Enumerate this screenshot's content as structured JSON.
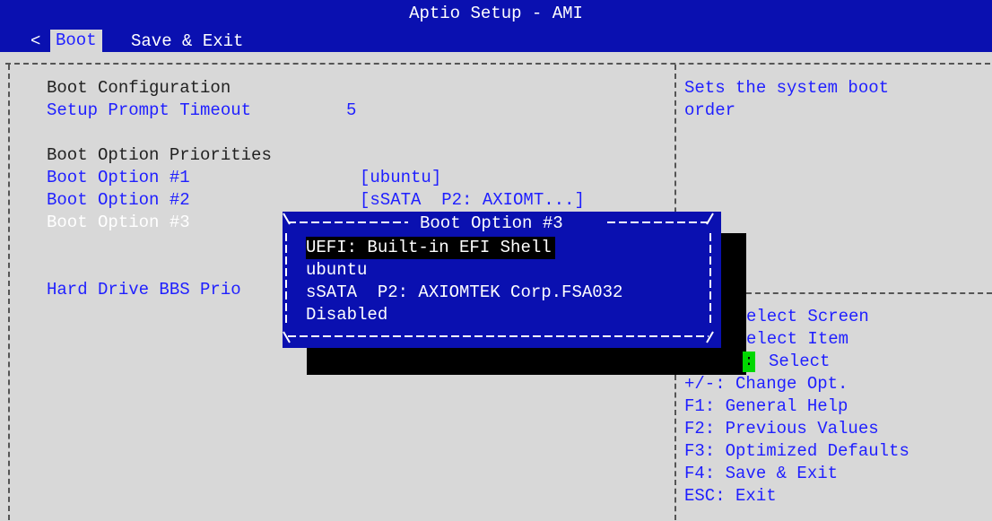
{
  "window": {
    "title": "Aptio Setup - AMI"
  },
  "tabs": {
    "left_arrow": "<",
    "items": [
      {
        "label": "Boot",
        "active": true
      },
      {
        "label": "Save & Exit",
        "active": false
      }
    ]
  },
  "main": {
    "boot_configuration_heading": "Boot Configuration",
    "setup_prompt_timeout": {
      "label": "Setup Prompt Timeout",
      "value": "5"
    },
    "boot_option_priorities_heading": "Boot Option Priorities",
    "boot_options": [
      {
        "label": "Boot Option #1",
        "value": "[ubuntu]"
      },
      {
        "label": "Boot Option #2",
        "value": "[sSATA  P2: AXIOMT...]"
      },
      {
        "label": "Boot Option #3",
        "value": ""
      }
    ],
    "hard_drive_bbs": {
      "label": "Hard Drive BBS Prio"
    }
  },
  "help": {
    "description_lines": [
      "Sets the system boot",
      "order"
    ]
  },
  "keys": {
    "select_screen_fragment": "elect Screen",
    "select_item_fragment": "elect Item",
    "select_marker": ":",
    "select_label": "Select",
    "change_opt": "+/-: Change Opt.",
    "general_help": "F1: General Help",
    "previous_values": "F2: Previous Values",
    "optimized_defaults": "F3: Optimized Defaults",
    "save_exit": "F4: Save & Exit",
    "esc_exit": "ESC: Exit"
  },
  "popup": {
    "title": "Boot Option #3",
    "options": [
      {
        "label": "UEFI: Built-in EFI Shell",
        "selected": true
      },
      {
        "label": "ubuntu",
        "selected": false
      },
      {
        "label": "sSATA  P2: AXIOMTEK Corp.FSA032",
        "selected": false
      },
      {
        "label": "Disabled",
        "selected": false
      }
    ]
  },
  "colors": {
    "bios_blue": "#0a10b0",
    "background_gray": "#d8d8d8",
    "option_blue_text": "#1f1fff",
    "highlight_green": "#00d800"
  }
}
